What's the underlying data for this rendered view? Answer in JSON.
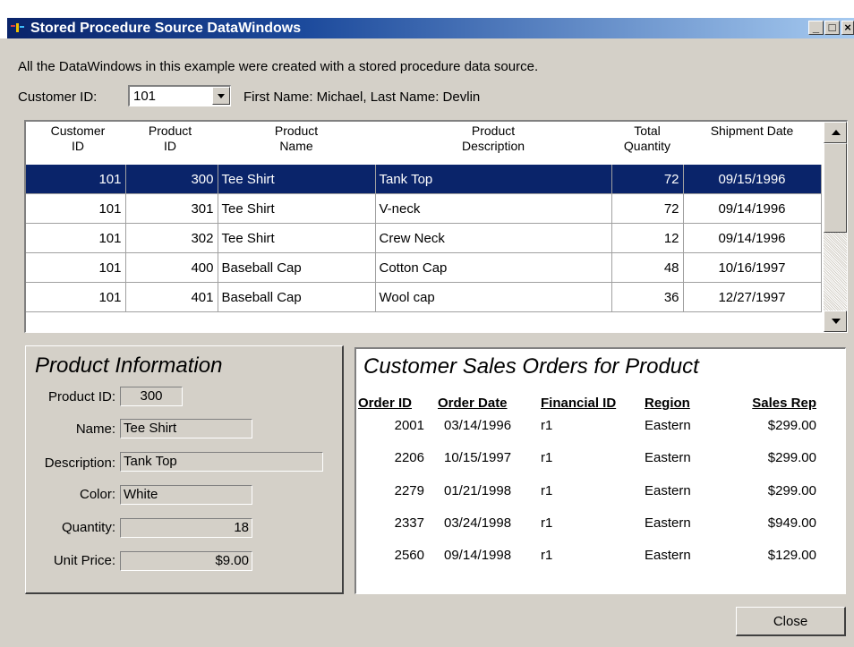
{
  "window": {
    "title": "Stored Procedure Source DataWindows",
    "min": "_",
    "max": "□",
    "close": "×"
  },
  "intro": "All the DataWindows in this example were created with a stored procedure data source.",
  "customer": {
    "label": "Customer ID:",
    "value": "101",
    "name_text": "First Name: Michael, Last Name: Devlin"
  },
  "grid": {
    "headers": [
      [
        "Customer",
        "ID"
      ],
      [
        "Product",
        "ID"
      ],
      [
        "Product",
        "Name"
      ],
      [
        "Product",
        "Description"
      ],
      [
        "Total",
        "Quantity"
      ],
      [
        "Shipment Date",
        ""
      ]
    ],
    "rows": [
      {
        "customer_id": "101",
        "product_id": "300",
        "name": "Tee Shirt",
        "description": "Tank Top",
        "quantity": "72",
        "date": "09/15/1996"
      },
      {
        "customer_id": "101",
        "product_id": "301",
        "name": "Tee Shirt",
        "description": "V-neck",
        "quantity": "72",
        "date": "09/14/1996"
      },
      {
        "customer_id": "101",
        "product_id": "302",
        "name": "Tee Shirt",
        "description": "Crew Neck",
        "quantity": "12",
        "date": "09/14/1996"
      },
      {
        "customer_id": "101",
        "product_id": "400",
        "name": "Baseball Cap",
        "description": "Cotton Cap",
        "quantity": "48",
        "date": "10/16/1997"
      },
      {
        "customer_id": "101",
        "product_id": "401",
        "name": "Baseball Cap",
        "description": "Wool cap",
        "quantity": "36",
        "date": "12/27/1997"
      }
    ]
  },
  "product_info": {
    "title": "Product Information",
    "product_id_label": "Product ID:",
    "product_id": "300",
    "name_label": "Name:",
    "name": "Tee Shirt",
    "description_label": "Description:",
    "description": "Tank Top",
    "color_label": "Color:",
    "color": "White",
    "quantity_label": "Quantity:",
    "quantity": "18",
    "unit_price_label": "Unit Price:",
    "unit_price": "$9.00"
  },
  "orders": {
    "title": "Customer Sales Orders for Product",
    "headers": [
      "Order ID",
      "Order Date",
      "Financial ID",
      "Region",
      "Sales Rep"
    ],
    "rows": [
      {
        "order_id": "2001",
        "date": "03/14/1996",
        "fin": "r1",
        "region": "Eastern",
        "rep": "$299.00"
      },
      {
        "order_id": "2206",
        "date": "10/15/1997",
        "fin": "r1",
        "region": "Eastern",
        "rep": "$299.00"
      },
      {
        "order_id": "2279",
        "date": "01/21/1998",
        "fin": "r1",
        "region": "Eastern",
        "rep": "$299.00"
      },
      {
        "order_id": "2337",
        "date": "03/24/1998",
        "fin": "r1",
        "region": "Eastern",
        "rep": "$949.00"
      },
      {
        "order_id": "2560",
        "date": "09/14/1998",
        "fin": "r1",
        "region": "Eastern",
        "rep": "$129.00"
      }
    ]
  },
  "close_label": "Close",
  "colors": {
    "title_bar": "#0a246a",
    "selection": "#0a246a",
    "face": "#d4d0c8"
  }
}
